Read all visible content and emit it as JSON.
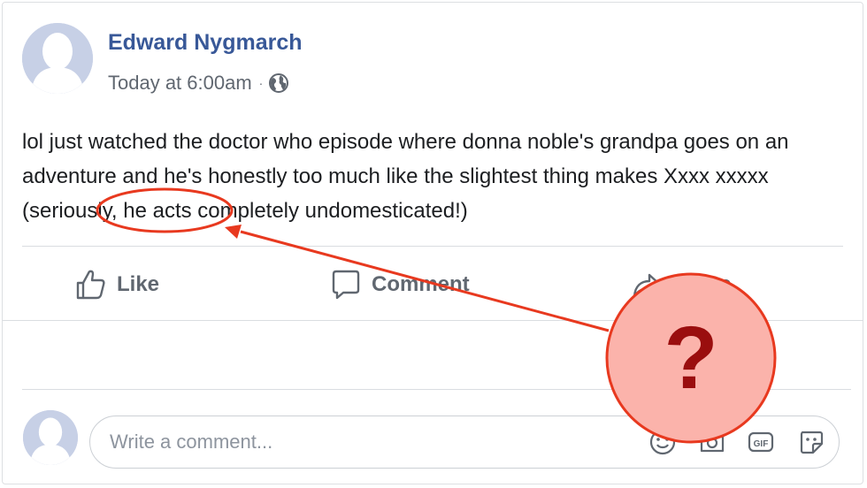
{
  "post": {
    "author": "Edward Nygmarch",
    "timestamp": "Today at 6:00am",
    "separator": "·",
    "privacy_icon": "globe-icon",
    "text": "lol just watched the doctor who episode where donna noble's grandpa goes on an adventure and he's honestly too much like the slightest thing makes Xxxx xxxxx (seriously, he acts completely undomesticated!)"
  },
  "actions": {
    "like_label": "Like",
    "comment_label": "Comment",
    "share_label": "Share"
  },
  "comment": {
    "placeholder": "Write a comment...",
    "icons": [
      "emoji-icon",
      "camera-icon",
      "gif-icon",
      "sticker-icon"
    ],
    "gif_label": "GIF"
  },
  "annotation": {
    "symbol": "?",
    "highlighted_text": "Xxxx xxxxx",
    "color": "#e8391f",
    "fill": "#fbb3ab"
  },
  "colors": {
    "author": "#385898",
    "secondary": "#606770",
    "avatar": "#c7d0e6"
  }
}
